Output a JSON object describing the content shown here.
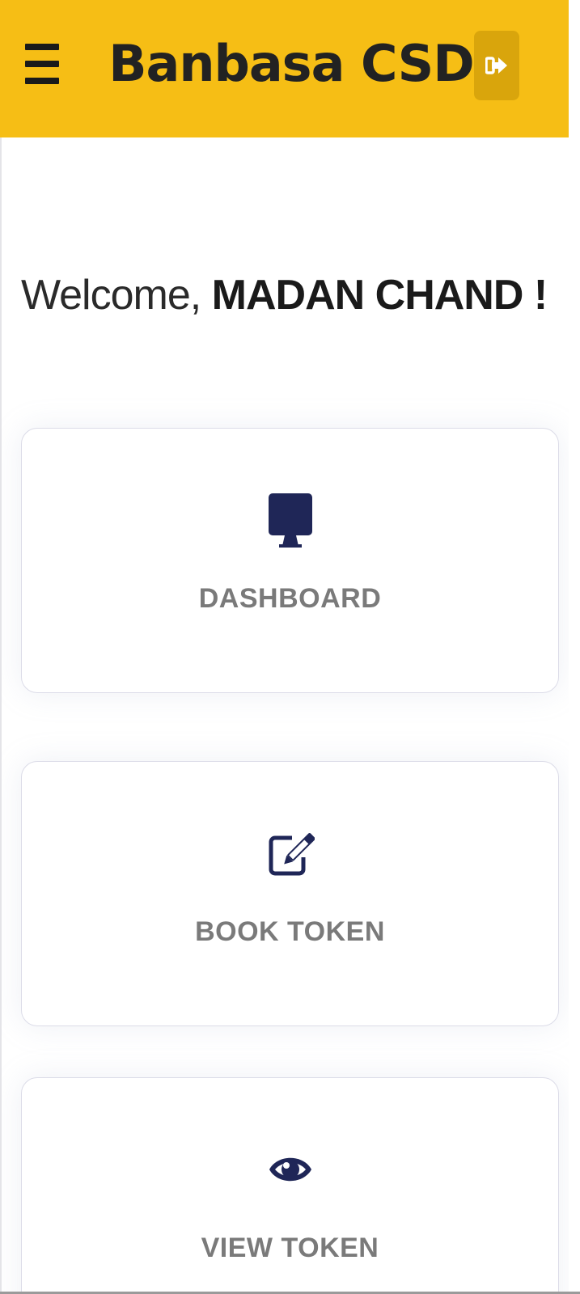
{
  "header": {
    "title": "Banbasa CSD",
    "background_color": "#f6be15",
    "menu_icon": "hamburger-menu-icon",
    "logout_icon": "sign-out-icon"
  },
  "welcome": {
    "greeting": "Welcome,",
    "user_name": "MADAN CHAND !"
  },
  "cards": [
    {
      "label": "DASHBOARD",
      "icon": "desktop-monitor-icon"
    },
    {
      "label": "BOOK TOKEN",
      "icon": "edit-pencil-square-icon"
    },
    {
      "label": "VIEW TOKEN",
      "icon": "eye-icon"
    }
  ],
  "colors": {
    "accent": "#f6be15",
    "icon_navy": "#1f2657",
    "label_gray": "#7a7a7a"
  }
}
